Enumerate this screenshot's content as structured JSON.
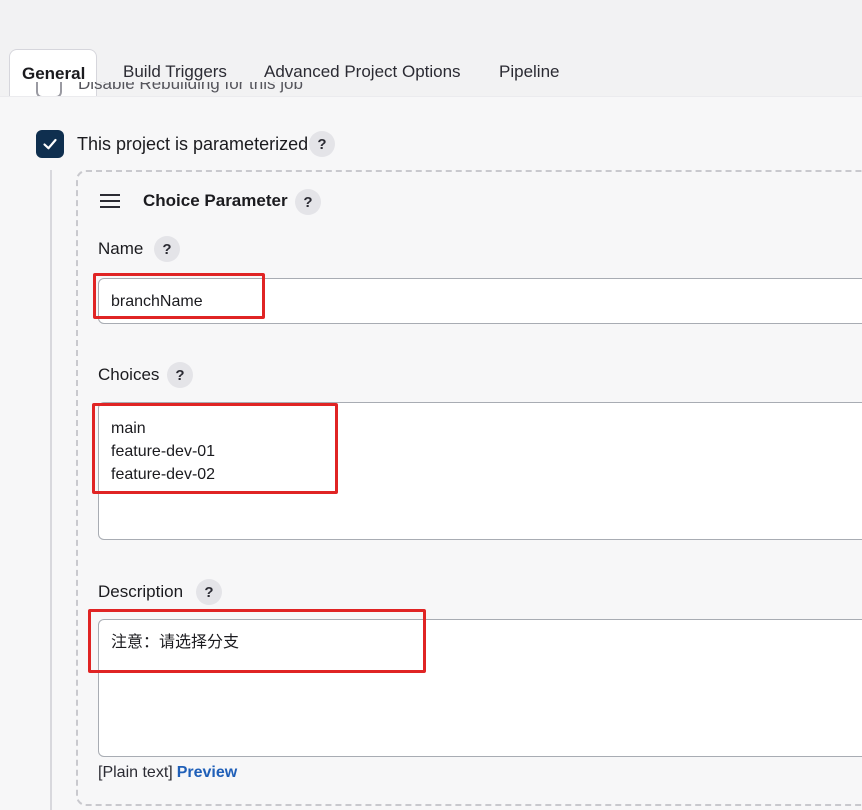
{
  "tabs": [
    {
      "label": "General",
      "active": true
    },
    {
      "label": "Build Triggers",
      "active": false
    },
    {
      "label": "Advanced Project Options",
      "active": false
    },
    {
      "label": "Pipeline",
      "active": false
    }
  ],
  "clipped_option": {
    "label": "Disable Rebuilding for this job",
    "checked": false
  },
  "parameterized": {
    "label": "This project is parameterized",
    "checked": true,
    "help": "?"
  },
  "parameter": {
    "title": "Choice Parameter",
    "help": "?",
    "name": {
      "label": "Name",
      "help": "?",
      "value": "branchName"
    },
    "choices": {
      "label": "Choices",
      "help": "?",
      "values": [
        "main",
        "feature-dev-01",
        "feature-dev-02"
      ]
    },
    "description": {
      "label": "Description",
      "help": "?",
      "value": "注意：请选择分支"
    },
    "format": {
      "plain_text": "[Plain text]",
      "preview_link": "Preview"
    }
  },
  "colors": {
    "checkbox_checked": "#0f2f4f",
    "highlight": "#e02424",
    "link": "#1f5fb8"
  }
}
